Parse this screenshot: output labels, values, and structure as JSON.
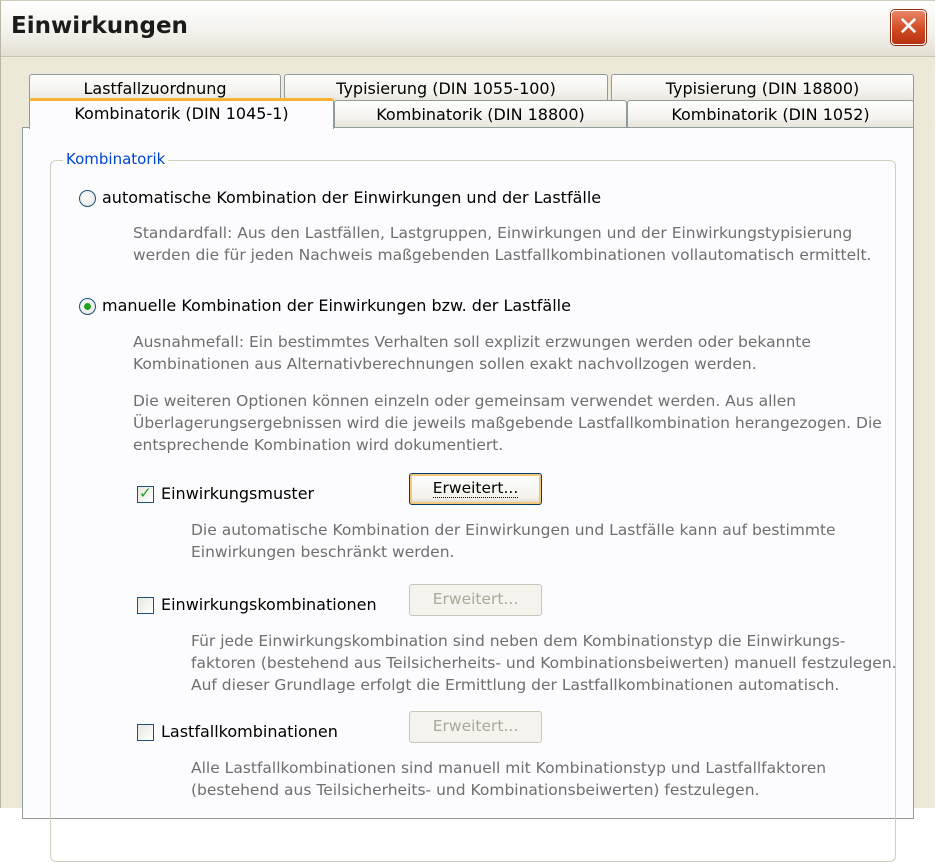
{
  "window": {
    "title": "Einwirkungen"
  },
  "tabs_row1": [
    {
      "label": "Lastfallzuordnung"
    },
    {
      "label": "Typisierung (DIN 1055-100)"
    },
    {
      "label": "Typisierung (DIN 18800)"
    }
  ],
  "tabs_row2": [
    {
      "label": "Kombinatorik (DIN 1045-1)",
      "active": true
    },
    {
      "label": "Kombinatorik (DIN 18800)"
    },
    {
      "label": "Kombinatorik (DIN 1052)"
    }
  ],
  "group": {
    "legend": "Kombinatorik",
    "auto": {
      "label": "automatische Kombination der Einwirkungen und der Lastfälle",
      "selected": false,
      "desc": [
        "Standardfall: Aus den Lastfällen, Lastgruppen, Einwirkungen und der Einwirkungstypisierung",
        "werden die für jeden Nachweis maßgebenden Lastfallkombinationen vollautomatisch ermittelt."
      ]
    },
    "manual": {
      "label": "manuelle Kombination der Einwirkungen bzw. der Lastfälle",
      "selected": true,
      "desc1": [
        "Ausnahmefall: Ein bestimmtes Verhalten soll explizit erzwungen werden oder bekannte",
        "Kombinationen aus Alternativberechnungen sollen exakt nachvollzogen werden."
      ],
      "desc2": [
        "Die weiteren Optionen können einzeln oder gemeinsam verwendet werden. Aus allen",
        "Überlagerungsergebnissen wird die jeweils maßgebende Lastfallkombination herangezogen. Die",
        "entsprechende Kombination wird dokumentiert."
      ]
    },
    "options": [
      {
        "label": "Einwirkungsmuster",
        "checked": true,
        "button": "Erweitert...",
        "button_enabled": true,
        "desc": [
          "Die automatische Kombination der Einwirkungen und Lastfälle kann auf bestimmte",
          "Einwirkungen beschränkt werden."
        ]
      },
      {
        "label": "Einwirkungskombinationen",
        "checked": false,
        "button": "Erweitert...",
        "button_enabled": false,
        "desc": [
          "Für jede Einwirkungskombination sind neben dem Kombinationstyp die Einwirkungs-",
          "faktoren (bestehend aus Teilsicherheits- und Kombinationsbeiwerten) manuell festzulegen.",
          "Auf dieser Grundlage erfolgt die Ermittlung der Lastfallkombinationen automatisch."
        ]
      },
      {
        "label": "Lastfallkombinationen",
        "checked": false,
        "button": "Erweitert...",
        "button_enabled": false,
        "desc": [
          "Alle Lastfallkombinationen sind manuell mit Kombinationstyp und Lastfallfaktoren",
          "(bestehend aus Teilsicherheits- und Kombinationsbeiwerten) festzulegen."
        ]
      }
    ]
  },
  "colors": {
    "accent_tab": "#f8b335",
    "legend": "#0046d5",
    "check": "#21a121",
    "close": "#d14a23"
  },
  "icons": {
    "close": "close-icon",
    "check": "checkmark-icon",
    "radio_dot": "radio-dot-icon"
  }
}
